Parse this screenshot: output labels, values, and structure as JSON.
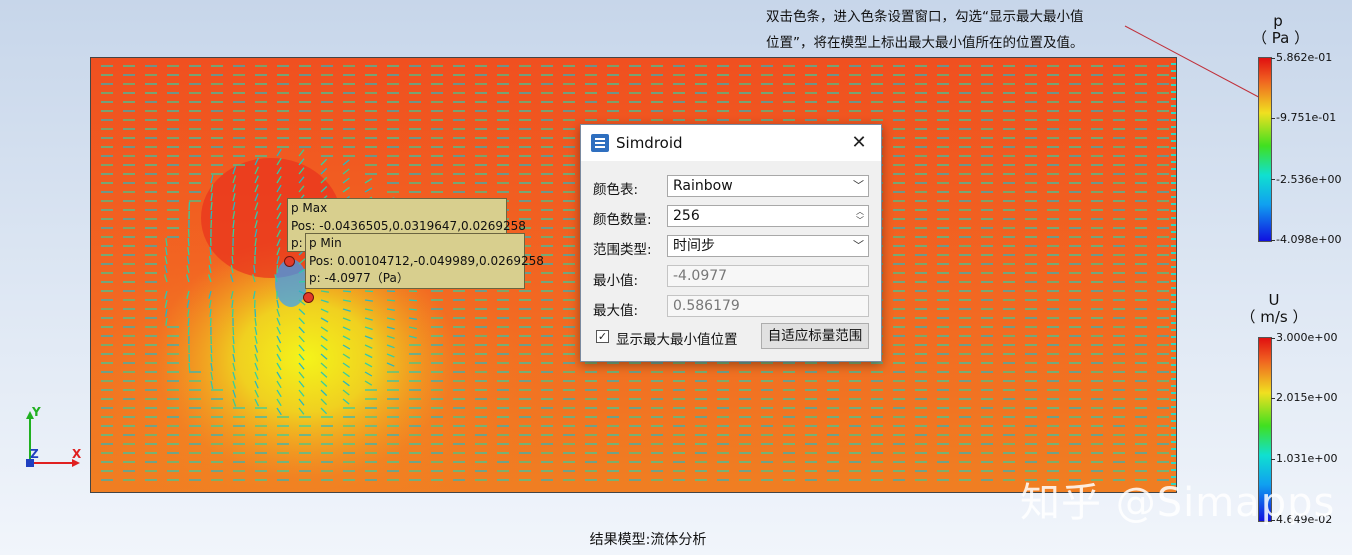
{
  "annotation": {
    "line1": "双击色条，进入色条设置窗口，勾选“显示最大最小值",
    "line2": "位置”，将在模型上标出最大最小值所在的位置及值。"
  },
  "tooltip_max": {
    "title": "p Max",
    "pos": "Pos: -0.0436505,0.0319647,0.0269258",
    "value": "p:"
  },
  "tooltip_min": {
    "title": "p Min",
    "pos": "Pos: 0.00104712,-0.049989,0.0269258",
    "value": "p: -4.0977（Pa）"
  },
  "axes": {
    "y": "Y",
    "z": "Z",
    "x": "X"
  },
  "colorbar_p": {
    "title_line1": "p",
    "title_line2": "（ Pa ）",
    "ticks": [
      "5.862e-01",
      "-9.751e-01",
      "-2.536e+00",
      "-4.098e+00"
    ]
  },
  "colorbar_u": {
    "title_line1": "U",
    "title_line2": "（ m/s ）",
    "ticks": [
      "3.000e+00",
      "2.015e+00",
      "1.031e+00",
      "4.649e-02"
    ]
  },
  "dialog": {
    "title": "Simdroid",
    "close_icon": "close-icon",
    "rows": {
      "color_table_label": "颜色表:",
      "color_table_value": "Rainbow",
      "color_count_label": "颜色数量:",
      "color_count_value": "256",
      "range_type_label": "范围类型:",
      "range_type_value": "时间步",
      "min_label": "最小值:",
      "min_value": "-4.0977",
      "max_label": "最大值:",
      "max_value": "0.586179"
    },
    "show_minmax_label": "显示最大最小值位置",
    "show_minmax_checked": true,
    "fit_button": "自适应标量范围"
  },
  "watermark": "知乎 @Simapps",
  "footer": "结果模型:流体分析"
}
